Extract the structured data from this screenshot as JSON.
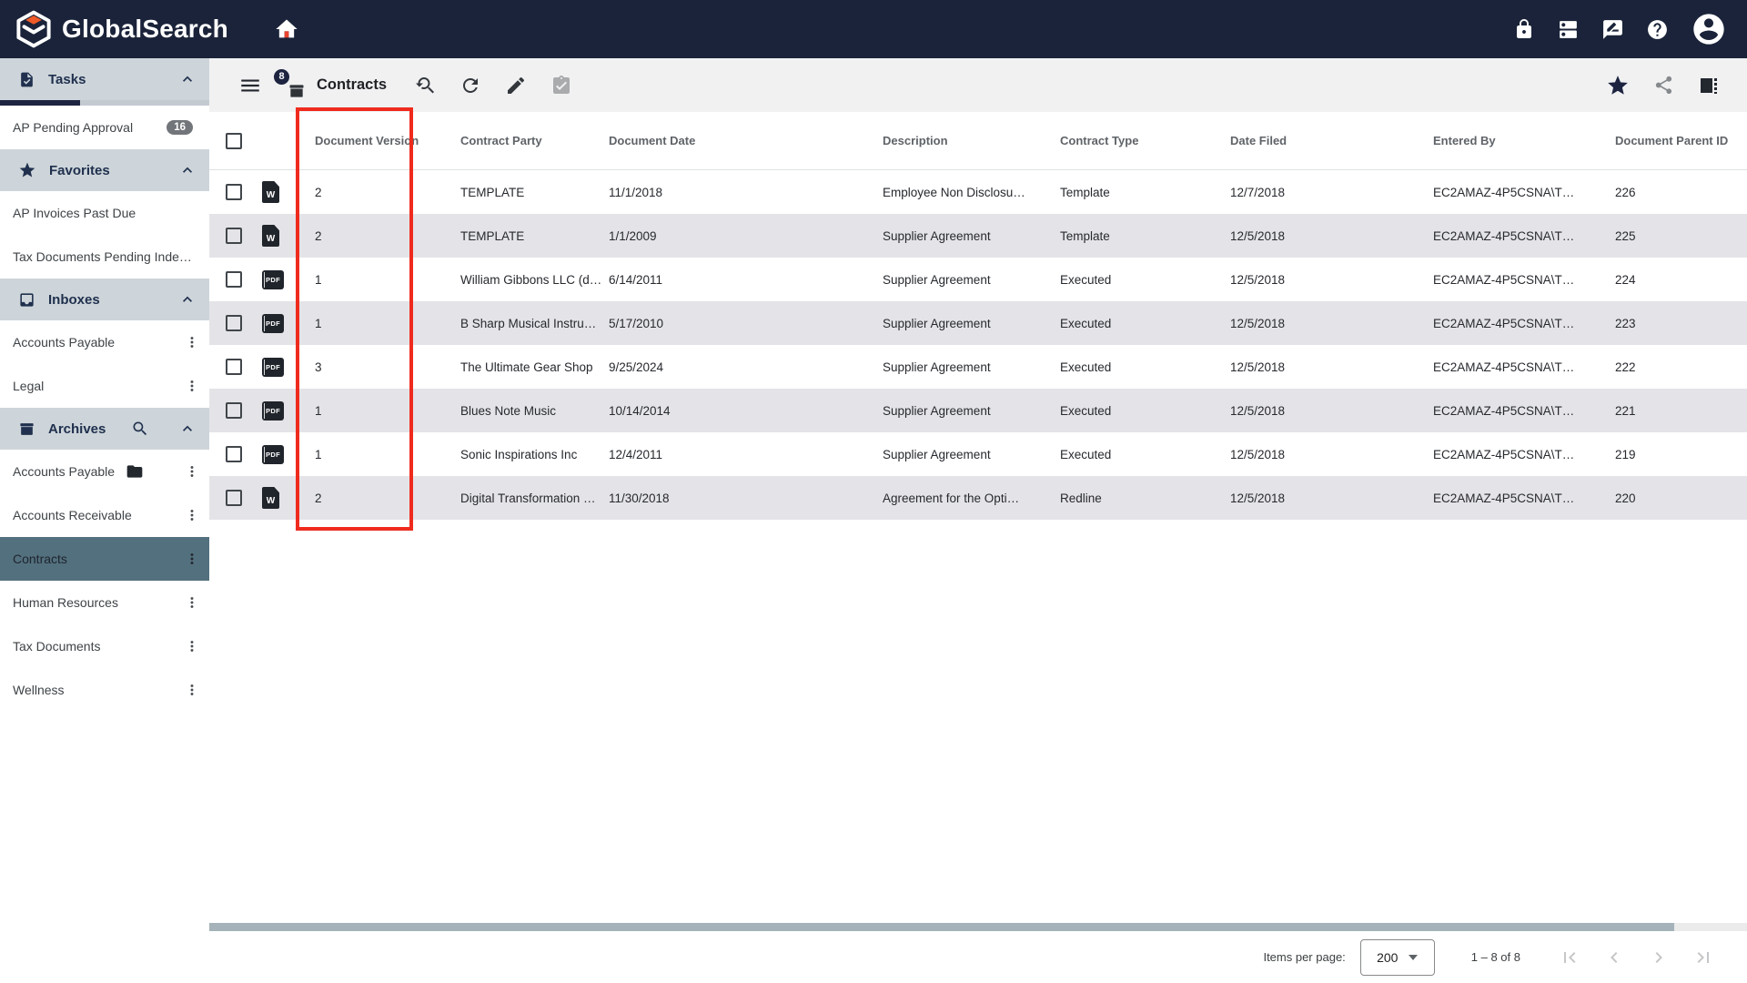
{
  "colors": {
    "topbar": "#1A2339",
    "accent_red": "#EF2B1E",
    "selected_archive": "#53707E",
    "header_bg": "#CDD5DA",
    "row_alt": "#E4E4E8",
    "badge_navy": "#1C2440"
  },
  "topbar": {
    "brand": "GlobalSearch"
  },
  "sidebar": {
    "tasks_label": "Tasks",
    "tasks_items": [
      {
        "label": "AP Pending Approval",
        "badge": "16"
      }
    ],
    "favorites_label": "Favorites",
    "favorites_items": [
      {
        "label": "AP Invoices Past Due"
      },
      {
        "label": "Tax Documents Pending Inde…"
      }
    ],
    "inboxes_label": "Inboxes",
    "inboxes_items": [
      {
        "label": "Accounts Payable"
      },
      {
        "label": "Legal"
      }
    ],
    "archives_label": "Archives",
    "archives_items": [
      {
        "label": "Accounts Payable"
      },
      {
        "label": "Accounts Receivable"
      },
      {
        "label": "Contracts"
      },
      {
        "label": "Human Resources"
      },
      {
        "label": "Tax Documents"
      },
      {
        "label": "Wellness"
      }
    ]
  },
  "toolbar": {
    "title": "Contracts",
    "badge": "8"
  },
  "table": {
    "columns": [
      "Document Version",
      "Contract Party",
      "Document Date",
      "Description",
      "Contract Type",
      "Date Filed",
      "Entered By",
      "Document Parent ID"
    ],
    "file_icon_labels": {
      "word": "W",
      "pdf": "PDF"
    },
    "rows": [
      {
        "file": "word",
        "version": "2",
        "party": "TEMPLATE",
        "document_date": "11/1/2018",
        "description": "Employee Non Disclosu…",
        "contract_type": "Template",
        "date_filed": "12/7/2018",
        "entered_by": "EC2AMAZ-4P5CSNA\\T…",
        "parent_id": "226"
      },
      {
        "file": "word",
        "version": "2",
        "party": "TEMPLATE",
        "document_date": "1/1/2009",
        "description": "Supplier Agreement",
        "contract_type": "Template",
        "date_filed": "12/5/2018",
        "entered_by": "EC2AMAZ-4P5CSNA\\T…",
        "parent_id": "225"
      },
      {
        "file": "pdf",
        "version": "1",
        "party": "William Gibbons LLC (d…",
        "document_date": "6/14/2011",
        "description": "Supplier Agreement",
        "contract_type": "Executed",
        "date_filed": "12/5/2018",
        "entered_by": "EC2AMAZ-4P5CSNA\\T…",
        "parent_id": "224"
      },
      {
        "file": "pdf",
        "version": "1",
        "party": "B Sharp Musical Instru…",
        "document_date": "5/17/2010",
        "description": "Supplier Agreement",
        "contract_type": "Executed",
        "date_filed": "12/5/2018",
        "entered_by": "EC2AMAZ-4P5CSNA\\T…",
        "parent_id": "223"
      },
      {
        "file": "pdf",
        "version": "3",
        "party": "The Ultimate Gear Shop",
        "document_date": "9/25/2024",
        "description": "Supplier Agreement",
        "contract_type": "Executed",
        "date_filed": "12/5/2018",
        "entered_by": "EC2AMAZ-4P5CSNA\\T…",
        "parent_id": "222"
      },
      {
        "file": "pdf",
        "version": "1",
        "party": "Blues Note Music",
        "document_date": "10/14/2014",
        "description": "Supplier Agreement",
        "contract_type": "Executed",
        "date_filed": "12/5/2018",
        "entered_by": "EC2AMAZ-4P5CSNA\\T…",
        "parent_id": "221"
      },
      {
        "file": "pdf",
        "version": "1",
        "party": "Sonic Inspirations Inc",
        "document_date": "12/4/2011",
        "description": "Supplier Agreement",
        "contract_type": "Executed",
        "date_filed": "12/5/2018",
        "entered_by": "EC2AMAZ-4P5CSNA\\T…",
        "parent_id": "219"
      },
      {
        "file": "word",
        "version": "2",
        "party": "Digital Transformation …",
        "document_date": "11/30/2018",
        "description": "Agreement for the Opti…",
        "contract_type": "Redline",
        "date_filed": "12/5/2018",
        "entered_by": "EC2AMAZ-4P5CSNA\\T…",
        "parent_id": "220"
      }
    ]
  },
  "pagination": {
    "items_per_page_label": "Items per page:",
    "page_size": "200",
    "range": "1 – 8 of 8"
  }
}
